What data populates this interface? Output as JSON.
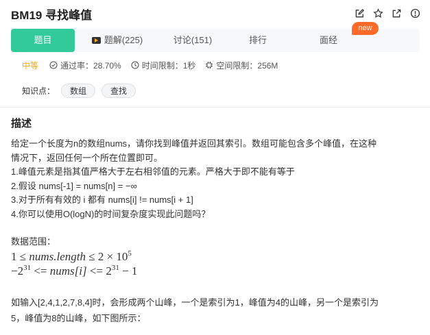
{
  "header": {
    "title": "BM19  寻找峰值",
    "icons": [
      "edit-icon",
      "star-icon",
      "share-icon",
      "info-icon"
    ]
  },
  "tabs": [
    {
      "label": "题目",
      "active": true
    },
    {
      "label": "题解(225)",
      "icon": "video-icon"
    },
    {
      "label": "讨论(151)"
    },
    {
      "label": "排行"
    },
    {
      "label": "面经",
      "badge": "new"
    }
  ],
  "meta": {
    "difficulty": "中等",
    "pass_rate": "通过率：28.70%",
    "time_limit": "时间限制：1秒",
    "space_limit": "空间限制：256M"
  },
  "knowledge": {
    "label": "知识点：",
    "tags": [
      "数组",
      "查找"
    ]
  },
  "description": {
    "title": "描述",
    "lines": [
      "给定一个长度为n的数组nums，请你找到峰值并返回其索引。数组可能包含多个峰值，在这种",
      "情况下，返回任何一个所在位置即可。",
      "1.峰值元素是指其值严格大于左右相邻值的元素。严格大于即不能有等于",
      "2.假设 nums[-1] = nums[n] = −∞",
      "3.对于所有有效的 i 都有 nums[i] != nums[i + 1]",
      "4.你可以使用O(logN)的时间复杂度实现此问题吗？"
    ],
    "range_label": "数据范围：",
    "math1": {
      "a": "1 ≤ ",
      "var": "nums.length",
      "b": " ≤ 2 × 10",
      "sup": "5"
    },
    "math2": {
      "a": "−2",
      "sup1": "31",
      "b": " <= ",
      "var": "nums[i]",
      "c": " <= 2",
      "sup2": "31",
      "d": " − 1"
    },
    "example_lines": [
      "如输入[2,4,1,2,7,8,4]时，会形成两个山峰，一个是索引为1，峰值为4的山峰，另一个是索引为",
      "5，峰值为8的山峰，如下图所示："
    ]
  },
  "colors": {
    "accent": "#32ca99",
    "difficulty": "#f5a623",
    "badge": "#ff6a2b"
  }
}
